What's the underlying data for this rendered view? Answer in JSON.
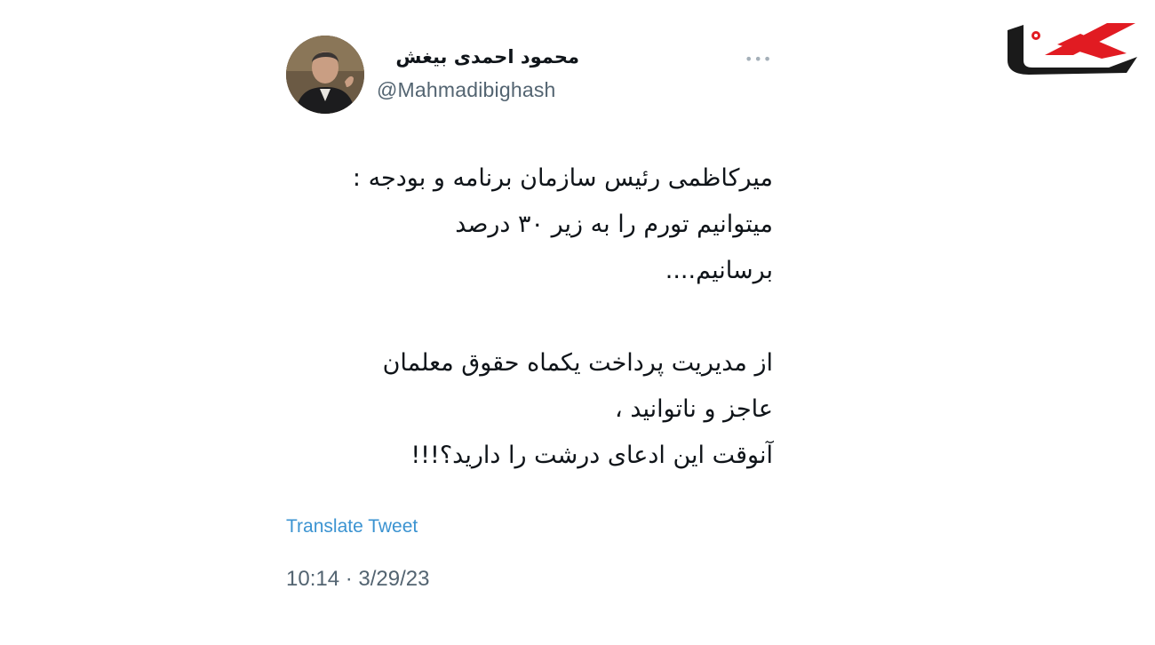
{
  "tweet": {
    "display_name": "محمود احمدی بیغش",
    "handle": "@Mahmadibighash",
    "more_icon": "more-horizontal-icon",
    "lines": [
      "میرکاظمی رئیس سازمان برنامه و بودجه :",
      "میتوانیم تورم را به زیر ۳۰ درصد",
      "برسانیم....",
      "از مدیریت پرداخت یکماه حقوق معلمان",
      "عاجز و ناتوانید ،",
      "آنوقت این ادعای درشت را دارید؟!!!"
    ],
    "translate_label": "Translate Tweet",
    "timestamp": "10:14 · 3/29/23"
  },
  "brand": {
    "logo": "rokna-logo",
    "accent_color": "#e11b22",
    "dark_color": "#1a1a1a"
  }
}
